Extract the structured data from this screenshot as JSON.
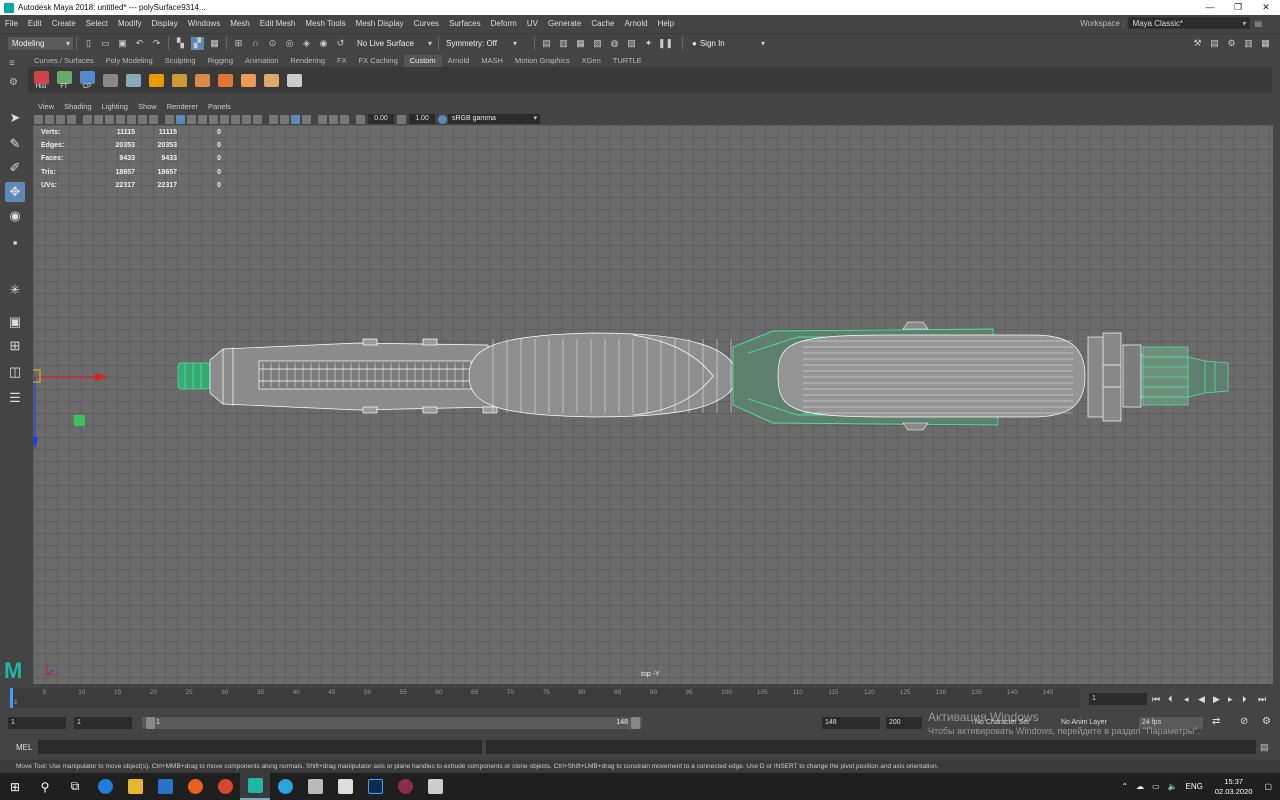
{
  "window": {
    "title": "Autodesk Maya 2018: untitled*   ---   polySurface9314...",
    "controls": [
      "—",
      "❐",
      "✕"
    ]
  },
  "menus": [
    "File",
    "Edit",
    "Create",
    "Select",
    "Modify",
    "Display",
    "Windows",
    "Mesh",
    "Edit Mesh",
    "Mesh Tools",
    "Mesh Display",
    "Curves",
    "Surfaces",
    "Deform",
    "UV",
    "Generate",
    "Cache",
    "Arnold",
    "Help"
  ],
  "workspace": {
    "label": "Workspace :",
    "value": "Maya Classic*"
  },
  "statusline": {
    "mode": "Modeling",
    "live_surface": "No Live Surface",
    "symmetry": "Symmetry: Off",
    "sign_in": "Sign In"
  },
  "shelf_tabs": [
    "Curves / Surfaces",
    "Poly Modeling",
    "Sculpting",
    "Rigging",
    "Animation",
    "Rendering",
    "FX",
    "FX Caching",
    "Custom",
    "Arnold",
    "MASH",
    "Motion Graphics",
    "XGen",
    "TURTLE"
  ],
  "shelf_active_tab": "Custom",
  "shelf_buttons": [
    {
      "label": "Hist",
      "color": "#c44"
    },
    {
      "label": "FT",
      "color": "#6a6"
    },
    {
      "label": "CP",
      "color": "#58c"
    },
    {
      "label": "",
      "color": "#888"
    },
    {
      "label": "",
      "color": "#8ab"
    },
    {
      "label": "",
      "color": "#e90"
    },
    {
      "label": "",
      "color": "#c93"
    },
    {
      "label": "",
      "color": "#d84"
    },
    {
      "label": "",
      "color": "#d73"
    },
    {
      "label": "",
      "color": "#e95"
    },
    {
      "label": "",
      "color": "#da6"
    },
    {
      "label": "",
      "color": "#ccc"
    }
  ],
  "panel_menus": [
    "View",
    "Shading",
    "Lighting",
    "Show",
    "Renderer",
    "Panels"
  ],
  "panel_toolbar": {
    "exposure": "0.00",
    "gamma": "1.00",
    "color_space": "sRGB gamma"
  },
  "hud": {
    "rows": [
      {
        "label": "Verts:",
        "a": "11115",
        "b": "11115",
        "c": "0"
      },
      {
        "label": "Edges:",
        "a": "20353",
        "b": "20353",
        "c": "0"
      },
      {
        "label": "Faces:",
        "a": "9433",
        "b": "9433",
        "c": "0"
      },
      {
        "label": "Tris:",
        "a": "18657",
        "b": "18657",
        "c": "0"
      },
      {
        "label": "UVs:",
        "a": "22317",
        "b": "22317",
        "c": "0"
      }
    ]
  },
  "viewport": {
    "camera": "top -Y"
  },
  "timeline": {
    "ticks": [
      "1",
      "5",
      "10",
      "15",
      "20",
      "25",
      "30",
      "35",
      "40",
      "45",
      "50",
      "55",
      "60",
      "65",
      "70",
      "75",
      "80",
      "85",
      "90",
      "95",
      "100",
      "105",
      "110",
      "115",
      "120",
      "125",
      "130",
      "135",
      "140",
      "145"
    ],
    "current_frame": "1",
    "range_start": "1",
    "playback_start": "1",
    "slider_start": "1",
    "slider_end": "148",
    "end_time": "148",
    "anim_end": "200",
    "character_set": "No Character Set",
    "anim_layer": "No Anim Layer",
    "fps": "24 fps"
  },
  "cmdline": {
    "label": "MEL"
  },
  "helpline": "Move Tool: Use manipulator to move object(s). Ctrl+MMB+drag to move components along normals. Shift+drag manipulator axis or plane handles to extrude components or clone objects. Ctrl+Shift+LMB+drag to constrain movement to a connected edge. Use D or INSERT to change the pivot position and axis orientation.",
  "activation": {
    "title": "Активация Windows",
    "body": "Чтобы активировать Windows, перейдите в раздел \"Параметры\"."
  },
  "taskbar": {
    "lang": "ENG",
    "time": "15:37",
    "date": "02.03.2020"
  },
  "colors": {
    "viewport_bg": "#6b6b6b",
    "wire_white": "#ffffff",
    "wire_green": "#4ee39a",
    "selection_green": "#3ac25a",
    "x_axis": "#e02020",
    "z_axis": "#2040e0",
    "active_tool": "#5c8ab5"
  }
}
